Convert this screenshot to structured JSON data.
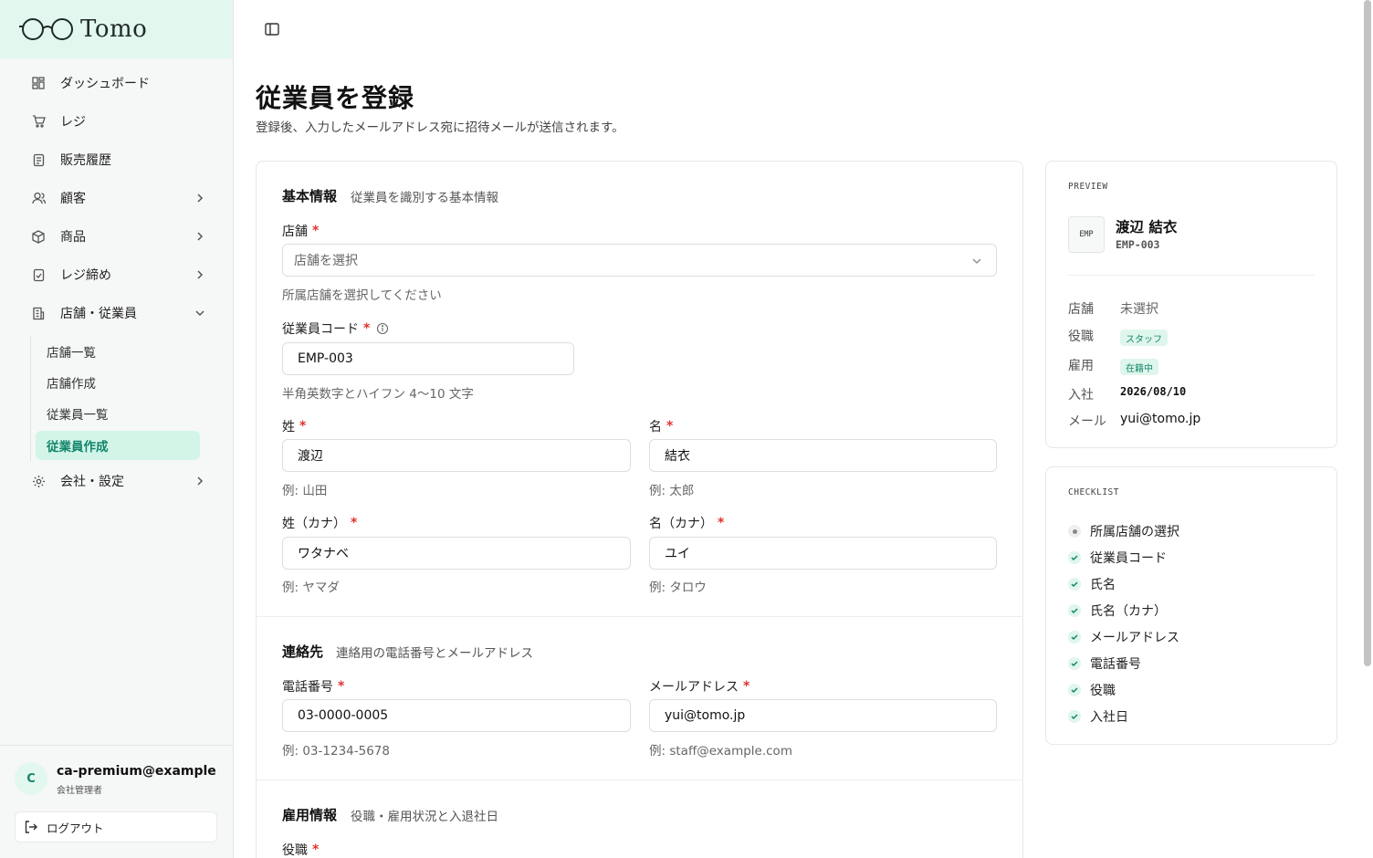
{
  "app": {
    "brand": "Tomo"
  },
  "sidebar": {
    "items": [
      {
        "label": "ダッシュボード",
        "icon": "dashboard-icon"
      },
      {
        "label": "レジ",
        "icon": "cart-icon"
      },
      {
        "label": "販売履歴",
        "icon": "receipt-icon"
      },
      {
        "label": "顧客",
        "icon": "users-icon"
      },
      {
        "label": "商品",
        "icon": "package-icon"
      },
      {
        "label": "レジ締め",
        "icon": "clipboard-check-icon"
      },
      {
        "label": "店舗・従業員",
        "icon": "building-icon"
      },
      {
        "label": "会社・設定",
        "icon": "gear-icon"
      }
    ],
    "sub_items": [
      {
        "label": "店舗一覧"
      },
      {
        "label": "店舗作成"
      },
      {
        "label": "従業員一覧"
      },
      {
        "label": "従業員作成",
        "active": true
      }
    ],
    "user": {
      "initial": "C",
      "email": "ca-premium@example.com",
      "role": "会社管理者"
    },
    "logout_label": "ログアウト"
  },
  "page": {
    "title": "従業員を登録",
    "subtitle": "登録後、入力したメールアドレス宛に招待メールが送信されます。"
  },
  "form": {
    "basic": {
      "title": "基本情報",
      "desc": "従業員を識別する基本情報",
      "store_label": "店舗",
      "store_placeholder": "店舗を選択",
      "store_hint": "所属店舗を選択してください",
      "code_label": "従業員コード",
      "code_value": "EMP-003",
      "code_hint": "半角英数字とハイフン 4〜10 文字",
      "last_name_label": "姓",
      "last_name_value": "渡辺",
      "last_name_hint": "例: 山田",
      "first_name_label": "名",
      "first_name_value": "結衣",
      "first_name_hint": "例: 太郎",
      "last_kana_label": "姓（カナ）",
      "last_kana_value": "ワタナベ",
      "last_kana_hint": "例: ヤマダ",
      "first_kana_label": "名（カナ）",
      "first_kana_value": "ユイ",
      "first_kana_hint": "例: タロウ"
    },
    "contact": {
      "title": "連絡先",
      "desc": "連絡用の電話番号とメールアドレス",
      "phone_label": "電話番号",
      "phone_value": "03-0000-0005",
      "phone_hint": "例: 03-1234-5678",
      "email_label": "メールアドレス",
      "email_value": "yui@tomo.jp",
      "email_hint": "例: staff@example.com"
    },
    "employment": {
      "title": "雇用情報",
      "desc": "役職・雇用状況と入退社日",
      "role_label": "役職"
    }
  },
  "preview": {
    "head": "PREVIEW",
    "badge": "EMP",
    "name": "渡辺 結衣",
    "code": "EMP-003",
    "rows": {
      "store_key": "店舗",
      "store_val": "未選択",
      "role_key": "役職",
      "role_val": "スタッフ",
      "employ_key": "雇用",
      "employ_val": "在籍中",
      "join_key": "入社",
      "join_val": "2026/08/10",
      "mail_key": "メール",
      "mail_val": "yui@tomo.jp"
    }
  },
  "checklist": {
    "head": "CHECKLIST",
    "items": [
      {
        "label": "所属店舗の選択",
        "done": false
      },
      {
        "label": "従業員コード",
        "done": true
      },
      {
        "label": "氏名",
        "done": true
      },
      {
        "label": "氏名（カナ）",
        "done": true
      },
      {
        "label": "メールアドレス",
        "done": true
      },
      {
        "label": "電話番号",
        "done": true
      },
      {
        "label": "役職",
        "done": true
      },
      {
        "label": "入社日",
        "done": true
      }
    ]
  },
  "colors": {
    "accent": "#13856b",
    "accent_bg": "#d2f5e8",
    "brand_bg": "#e2f8ef",
    "required": "#e0322e"
  }
}
